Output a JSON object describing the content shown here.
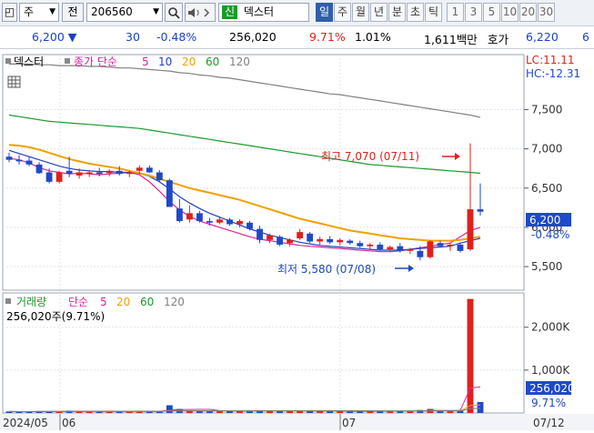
{
  "toolbar": {
    "code_type": "주",
    "prev_label": "전",
    "stock_code": "206560",
    "credit_badge": "신",
    "stock_name": "덱스터",
    "periods": [
      "일",
      "주",
      "월",
      "년",
      "분",
      "초",
      "틱"
    ],
    "active_period": "일",
    "minute_steps": [
      "1",
      "3",
      "5",
      "10",
      "20",
      "30"
    ]
  },
  "quote": {
    "price": "6,200",
    "change": "30",
    "change_pct": "-0.48%",
    "volume": "256,020",
    "volume_ratio": "9.71%",
    "turnover_ratio": "1.01%",
    "amount": "1,611백만",
    "bid_label": "호가",
    "bid_price": "6,220",
    "bid_extra": "6"
  },
  "price_panel": {
    "title": "덱스터",
    "legend_label": "종가 단순",
    "ma_periods": [
      "5",
      "10",
      "20",
      "60",
      "120"
    ],
    "ma_colors": [
      "#e0249a",
      "#1f3fbf",
      "#f0a000",
      "#1a9a2a",
      "#808080"
    ],
    "lc_text": "LC:11.11",
    "hc_text": "HC:-12.31",
    "y_ticks": [
      "7,500",
      "7,000",
      "6,500",
      "6,000",
      "5,500"
    ],
    "current_price": "6,200",
    "current_change": "-0.48%",
    "high_annotation": "최고 7,070 (07/11)",
    "low_annotation": "최저 5,580 (07/08)"
  },
  "volume_panel": {
    "legend_label": "거래량",
    "legend_ma": "단순",
    "ma_periods": [
      "5",
      "20",
      "60",
      "120"
    ],
    "current_volume": "256,020주(9.71%)",
    "y_ticks": [
      "2,000K",
      "1,000K"
    ],
    "current_value": "256,020",
    "current_pct": "9.71%"
  },
  "x_axis": {
    "labels": [
      "2024/05",
      "06",
      "07",
      "07/12"
    ]
  },
  "colors": {
    "up": "#e0201b",
    "down": "#1f49c8",
    "accent": "#2f5fa8"
  },
  "chart_data": {
    "type": "candlestick",
    "price_ylim": [
      5200,
      8200
    ],
    "volume_ylim": [
      0,
      2800
    ],
    "volume_unit": "K",
    "series": [
      {
        "name": "5",
        "values": [
          6880,
          6860,
          6820,
          6760,
          6720,
          6700,
          6680,
          6690,
          6680,
          6670,
          6680,
          6690,
          6700,
          6670,
          6580,
          6460,
          6330,
          6220,
          6140,
          6080,
          6040,
          6000,
          5960,
          5920,
          5880,
          5850,
          5830,
          5810,
          5790,
          5770,
          5760,
          5750,
          5740,
          5730,
          5720,
          5710,
          5700,
          5690,
          5690,
          5700,
          5720,
          5740,
          5760,
          5780,
          5800,
          5880,
          5960,
          6000
        ]
      },
      {
        "name": "10",
        "values": [
          6980,
          6940,
          6900,
          6860,
          6820,
          6780,
          6750,
          6730,
          6720,
          6710,
          6710,
          6700,
          6700,
          6690,
          6650,
          6580,
          6490,
          6390,
          6310,
          6240,
          6180,
          6130,
          6080,
          6030,
          5980,
          5940,
          5900,
          5870,
          5840,
          5810,
          5790,
          5770,
          5760,
          5750,
          5740,
          5730,
          5720,
          5710,
          5710,
          5710,
          5720,
          5730,
          5740,
          5750,
          5760,
          5800,
          5830,
          5860
        ]
      },
      {
        "name": "20",
        "values": [
          7050,
          7040,
          7020,
          6990,
          6950,
          6910,
          6870,
          6840,
          6810,
          6790,
          6770,
          6750,
          6720,
          6690,
          6660,
          6620,
          6580,
          6540,
          6500,
          6470,
          6440,
          6410,
          6380,
          6350,
          6310,
          6270,
          6230,
          6190,
          6150,
          6110,
          6080,
          6050,
          6020,
          5990,
          5960,
          5940,
          5920,
          5900,
          5880,
          5860,
          5850,
          5840,
          5830,
          5830,
          5830,
          5840,
          5860,
          5880
        ]
      },
      {
        "name": "60",
        "values": [
          7430,
          7410,
          7390,
          7370,
          7350,
          7340,
          7330,
          7320,
          7310,
          7300,
          7290,
          7280,
          7270,
          7260,
          7240,
          7220,
          7200,
          7180,
          7160,
          7140,
          7120,
          7100,
          7080,
          7060,
          7040,
          7020,
          7000,
          6980,
          6960,
          6940,
          6920,
          6900,
          6880,
          6860,
          6840,
          6820,
          6800,
          6790,
          6780,
          6770,
          6760,
          6750,
          6740,
          6730,
          6720,
          6710,
          6700,
          6690
        ]
      },
      {
        "name": "120",
        "values": [
          8080,
          8080,
          8080,
          8070,
          8070,
          8060,
          8060,
          8060,
          8050,
          8050,
          8040,
          8030,
          8030,
          8020,
          8010,
          8000,
          7990,
          7970,
          7960,
          7940,
          7930,
          7910,
          7900,
          7880,
          7860,
          7840,
          7820,
          7800,
          7780,
          7760,
          7740,
          7720,
          7700,
          7690,
          7670,
          7650,
          7630,
          7610,
          7590,
          7570,
          7550,
          7530,
          7510,
          7490,
          7470,
          7450,
          7430,
          7400
        ]
      }
    ],
    "candles": [
      {
        "o": 6900,
        "h": 6950,
        "l": 6830,
        "c": 6860
      },
      {
        "o": 6860,
        "h": 6920,
        "l": 6800,
        "c": 6840
      },
      {
        "o": 6850,
        "h": 6900,
        "l": 6780,
        "c": 6800
      },
      {
        "o": 6800,
        "h": 6830,
        "l": 6680,
        "c": 6690
      },
      {
        "o": 6700,
        "h": 6750,
        "l": 6560,
        "c": 6580
      },
      {
        "o": 6580,
        "h": 6720,
        "l": 6560,
        "c": 6700
      },
      {
        "o": 6720,
        "h": 6900,
        "l": 6640,
        "c": 6680
      },
      {
        "o": 6660,
        "h": 6750,
        "l": 6620,
        "c": 6700
      },
      {
        "o": 6680,
        "h": 6730,
        "l": 6640,
        "c": 6700
      },
      {
        "o": 6700,
        "h": 6760,
        "l": 6650,
        "c": 6680
      },
      {
        "o": 6690,
        "h": 6740,
        "l": 6650,
        "c": 6720
      },
      {
        "o": 6720,
        "h": 6780,
        "l": 6660,
        "c": 6680
      },
      {
        "o": 6680,
        "h": 6720,
        "l": 6640,
        "c": 6700
      },
      {
        "o": 6720,
        "h": 6790,
        "l": 6680,
        "c": 6760
      },
      {
        "o": 6760,
        "h": 6790,
        "l": 6690,
        "c": 6700
      },
      {
        "o": 6700,
        "h": 6730,
        "l": 6580,
        "c": 6600
      },
      {
        "o": 6600,
        "h": 6620,
        "l": 6260,
        "c": 6260
      },
      {
        "o": 6240,
        "h": 6360,
        "l": 6060,
        "c": 6080
      },
      {
        "o": 6100,
        "h": 6280,
        "l": 6060,
        "c": 6180
      },
      {
        "o": 6180,
        "h": 6210,
        "l": 6060,
        "c": 6080
      },
      {
        "o": 6080,
        "h": 6120,
        "l": 6020,
        "c": 6060
      },
      {
        "o": 6060,
        "h": 6140,
        "l": 6040,
        "c": 6100
      },
      {
        "o": 6100,
        "h": 6120,
        "l": 6020,
        "c": 6040
      },
      {
        "o": 6040,
        "h": 6100,
        "l": 6000,
        "c": 6080
      },
      {
        "o": 6060,
        "h": 6080,
        "l": 5960,
        "c": 5980
      },
      {
        "o": 5980,
        "h": 6020,
        "l": 5800,
        "c": 5840
      },
      {
        "o": 5840,
        "h": 5920,
        "l": 5800,
        "c": 5900
      },
      {
        "o": 5880,
        "h": 5900,
        "l": 5760,
        "c": 5780
      },
      {
        "o": 5800,
        "h": 5860,
        "l": 5760,
        "c": 5840
      },
      {
        "o": 5860,
        "h": 5980,
        "l": 5840,
        "c": 5940
      },
      {
        "o": 5920,
        "h": 5940,
        "l": 5800,
        "c": 5820
      },
      {
        "o": 5820,
        "h": 5880,
        "l": 5780,
        "c": 5850
      },
      {
        "o": 5850,
        "h": 5890,
        "l": 5790,
        "c": 5810
      },
      {
        "o": 5810,
        "h": 5860,
        "l": 5770,
        "c": 5840
      },
      {
        "o": 5830,
        "h": 5850,
        "l": 5780,
        "c": 5800
      },
      {
        "o": 5800,
        "h": 5830,
        "l": 5740,
        "c": 5760
      },
      {
        "o": 5760,
        "h": 5800,
        "l": 5720,
        "c": 5780
      },
      {
        "o": 5780,
        "h": 5810,
        "l": 5700,
        "c": 5720
      },
      {
        "o": 5720,
        "h": 5770,
        "l": 5690,
        "c": 5750
      },
      {
        "o": 5760,
        "h": 5800,
        "l": 5680,
        "c": 5700
      },
      {
        "o": 5700,
        "h": 5740,
        "l": 5660,
        "c": 5720
      },
      {
        "o": 5700,
        "h": 5760,
        "l": 5580,
        "c": 5620
      },
      {
        "o": 5620,
        "h": 5840,
        "l": 5600,
        "c": 5820
      },
      {
        "o": 5800,
        "h": 5830,
        "l": 5740,
        "c": 5760
      },
      {
        "o": 5760,
        "h": 5800,
        "l": 5700,
        "c": 5780
      },
      {
        "o": 5780,
        "h": 5800,
        "l": 5680,
        "c": 5700
      },
      {
        "o": 5720,
        "h": 7070,
        "l": 5700,
        "c": 6230
      },
      {
        "o": 6230,
        "h": 6560,
        "l": 6150,
        "c": 6200
      }
    ],
    "volume": [
      35,
      30,
      28,
      40,
      38,
      32,
      55,
      45,
      30,
      28,
      42,
      30,
      36,
      50,
      40,
      38,
      180,
      95,
      60,
      50,
      40,
      35,
      45,
      38,
      48,
      65,
      50,
      42,
      40,
      48,
      45,
      38,
      36,
      40,
      35,
      42,
      38,
      45,
      40,
      42,
      38,
      70,
      95,
      55,
      40,
      48,
      2660,
      256
    ]
  }
}
